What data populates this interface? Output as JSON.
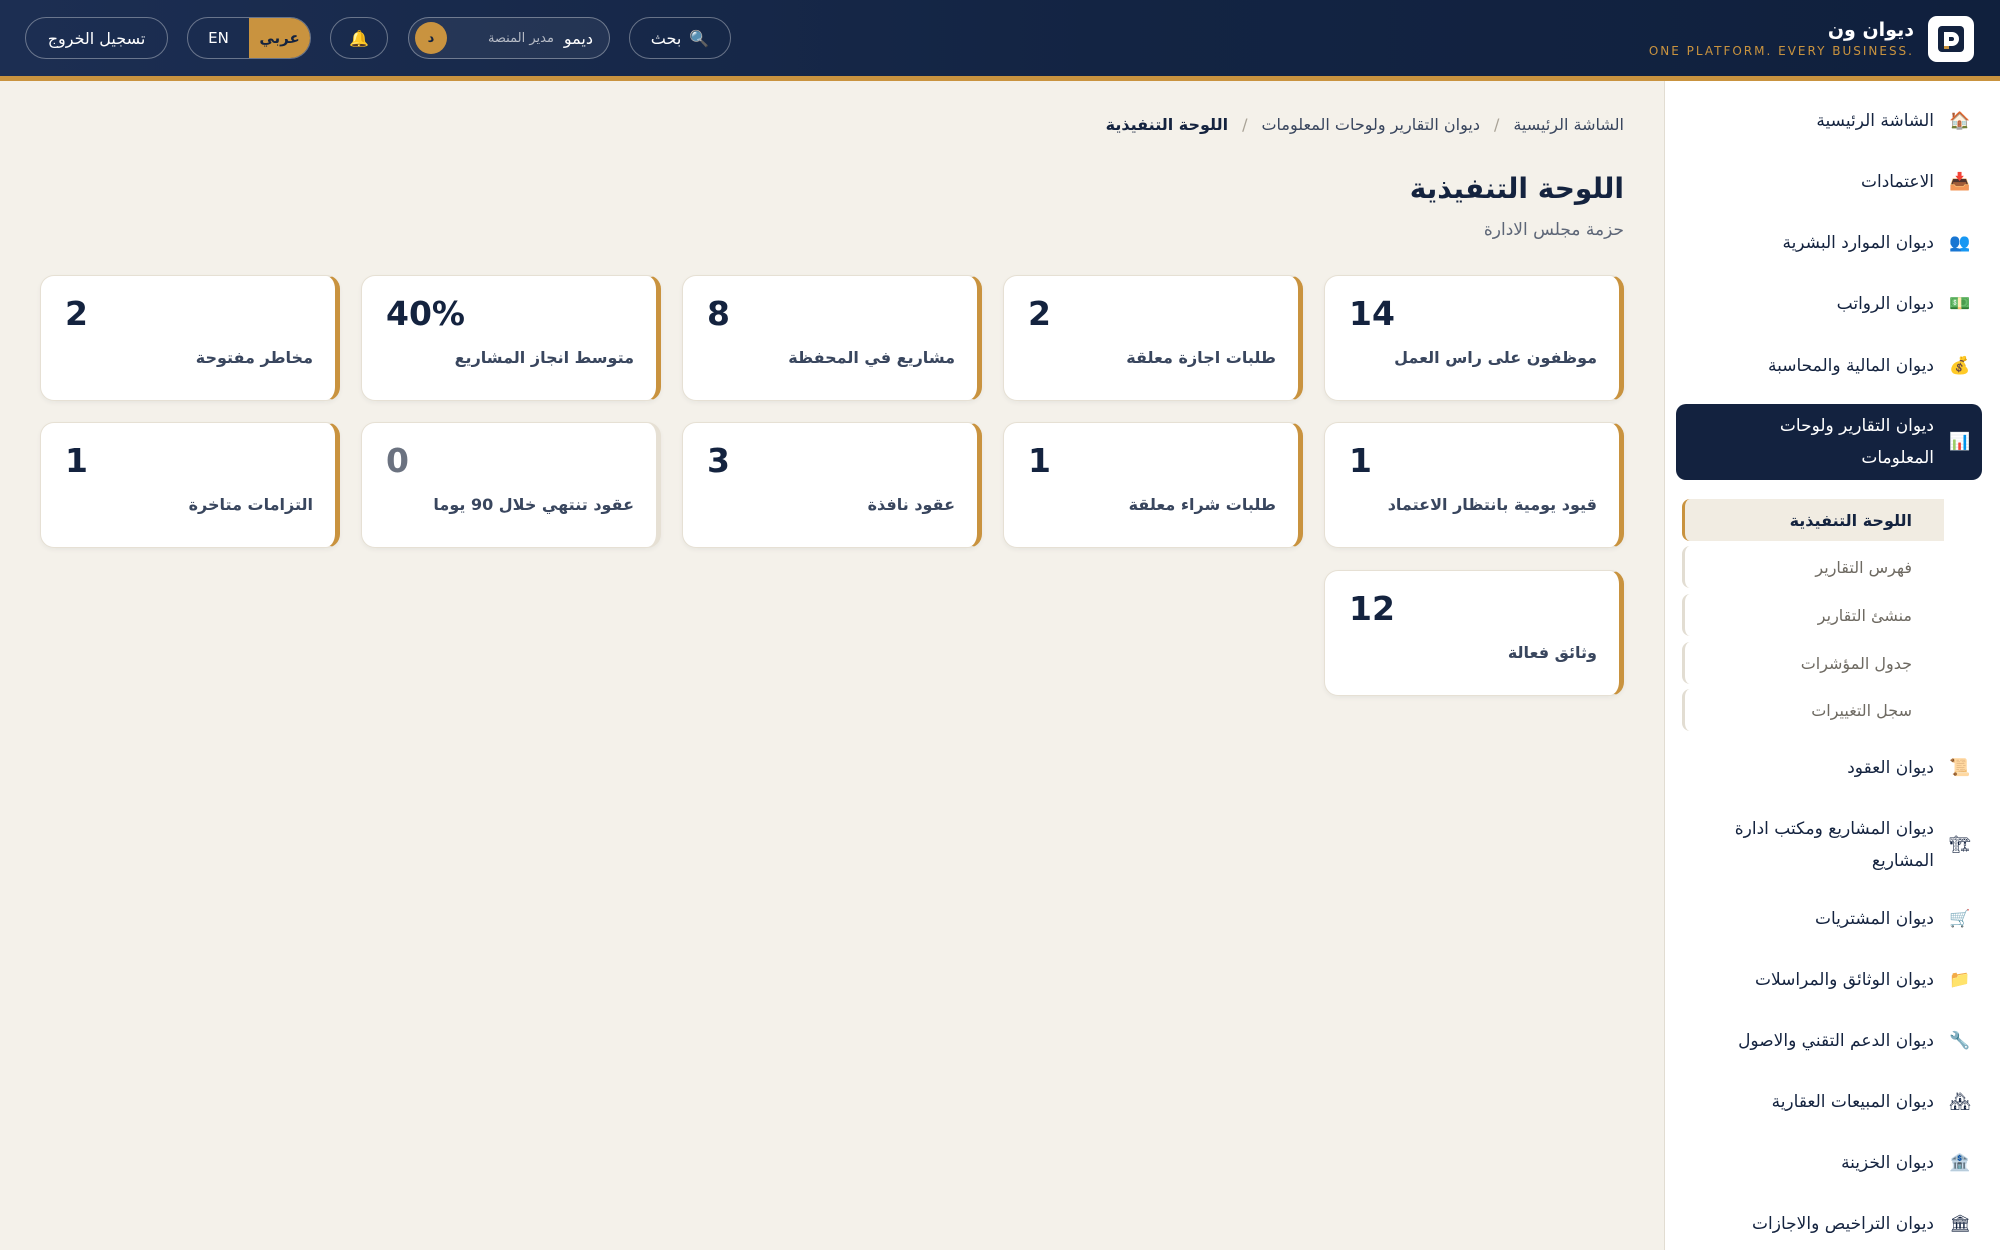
{
  "header": {
    "brand_name": "ديوان ون",
    "brand_tagline": "ONE PLATFORM. EVERY BUSINESS.",
    "search_label": "بحث",
    "user_initial": "د",
    "user_name": "ديمو",
    "user_role": "مدير المنصة",
    "lang_ar": "عربي",
    "lang_en": "EN",
    "logout_label": "تسجيل الخروج"
  },
  "sidebar": {
    "items": [
      {
        "label": "الشاشة الرئيسية",
        "icon": "home-icon"
      },
      {
        "label": "الاعتمادات",
        "icon": "inbox-tray-icon"
      },
      {
        "label": "ديوان الموارد البشرية",
        "icon": "people-icon"
      },
      {
        "label": "ديوان الرواتب",
        "icon": "money-icon"
      },
      {
        "label": "ديوان المالية والمحاسبة",
        "icon": "money-bag-icon"
      },
      {
        "label": "ديوان التقارير ولوحات المعلومات",
        "icon": "bar-chart-icon",
        "active": true
      },
      {
        "label": "ديوان العقود",
        "icon": "scroll-icon"
      },
      {
        "label": "ديوان المشاريع ومكتب ادارة المشاريع",
        "icon": "construction-icon"
      },
      {
        "label": "ديوان المشتريات",
        "icon": "cart-icon"
      },
      {
        "label": "ديوان الوثائق والمراسلات",
        "icon": "folder-icon"
      },
      {
        "label": "ديوان الدعم التقني والاصول",
        "icon": "wrench-icon"
      },
      {
        "label": "ديوان المبيعات العقارية",
        "icon": "houses-icon"
      },
      {
        "label": "ديوان الخزينة",
        "icon": "bank-icon"
      },
      {
        "label": "ديوان التراخيص والاجازات",
        "icon": "classical-building-icon"
      }
    ],
    "subitems": [
      {
        "label": "اللوحة التنفيذية",
        "current": true
      },
      {
        "label": "فهرس التقارير"
      },
      {
        "label": "منشئ التقارير"
      },
      {
        "label": "جدول المؤشرات"
      },
      {
        "label": "سجل التغييرات"
      }
    ]
  },
  "breadcrumb": {
    "home": "الشاشة الرئيسية",
    "section": "ديوان التقارير ولوحات المعلومات",
    "current": "اللوحة التنفيذية"
  },
  "page": {
    "title": "اللوحة التنفيذية",
    "subtitle": "حزمة مجلس الادارة"
  },
  "cards": [
    {
      "value": "14",
      "label": "موظفون على راس العمل"
    },
    {
      "value": "2",
      "label": "طلبات اجازة معلقة"
    },
    {
      "value": "8",
      "label": "مشاريع في المحفظة"
    },
    {
      "value": "40%",
      "label": "متوسط انجاز المشاريع"
    },
    {
      "value": "2",
      "label": "مخاطر مفتوحة"
    },
    {
      "value": "1",
      "label": "قيود يومية بانتظار الاعتماد"
    },
    {
      "value": "1",
      "label": "طلبات شراء معلقة"
    },
    {
      "value": "3",
      "label": "عقود نافذة"
    },
    {
      "value": "0",
      "label": "عقود تنتهي خلال 90 يوما"
    },
    {
      "value": "1",
      "label": "التزامات متاخرة"
    },
    {
      "value": "12",
      "label": "وثائق فعالة"
    }
  ],
  "colors": {
    "navy": "#13223f",
    "gold": "#c9933f",
    "background": "#f4f1ea"
  }
}
